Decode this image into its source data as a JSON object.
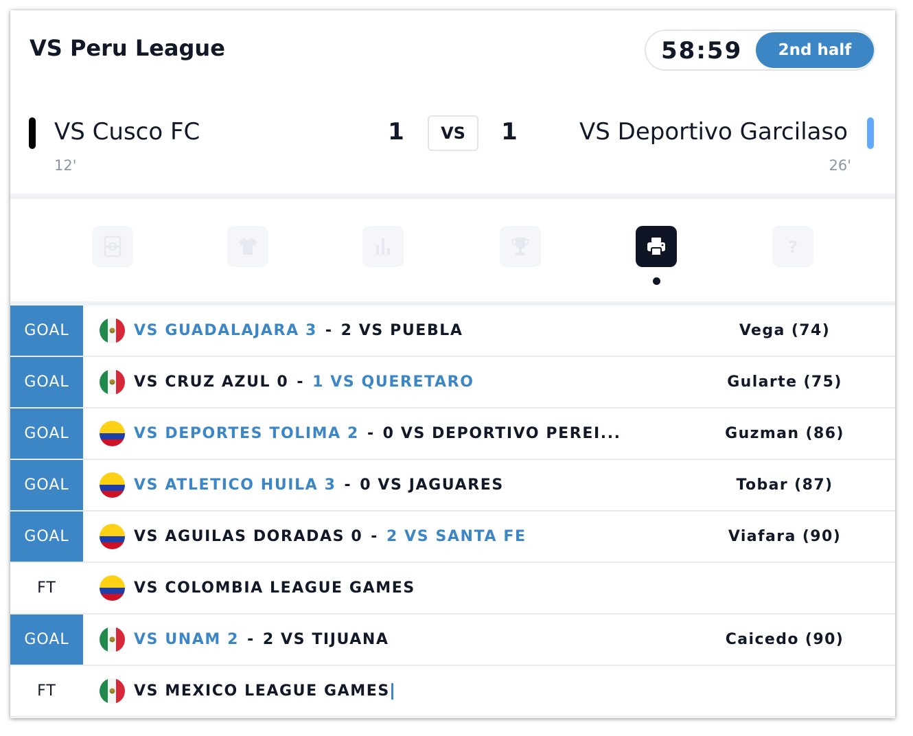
{
  "header": {
    "league": "VS Peru League",
    "clock": "58:59",
    "period": "2nd half",
    "home": {
      "name": "VS Cusco FC",
      "score": "1",
      "minute": "12'",
      "color": "#000000"
    },
    "away": {
      "name": "VS Deportivo Garcilaso",
      "score": "1",
      "minute": "26'",
      "color": "#63a9ff"
    },
    "vs_label": "VS"
  },
  "tabs": [
    {
      "icon": "pitch-icon",
      "active": false
    },
    {
      "icon": "jersey-icon",
      "active": false
    },
    {
      "icon": "stats-icon",
      "active": false
    },
    {
      "icon": "trophy-icon",
      "active": false
    },
    {
      "icon": "printer-icon",
      "active": true
    },
    {
      "icon": "question-icon",
      "active": false
    }
  ],
  "feed": [
    {
      "tag": "GOAL",
      "flag": "mexico-flag-icon",
      "home": "VS GUADALAJARA 3",
      "away": "2 VS PUEBLA",
      "highlight": "home",
      "scorer": "Vega (74)"
    },
    {
      "tag": "GOAL",
      "flag": "mexico-flag-icon",
      "home": "VS CRUZ AZUL 0",
      "away": "1 VS QUERETARO",
      "highlight": "away",
      "scorer": "Gularte (75)"
    },
    {
      "tag": "GOAL",
      "flag": "colombia-flag-icon",
      "home": "VS DEPORTES TOLIMA 2",
      "away": "0 VS DEPORTIVO PEREI...",
      "highlight": "home",
      "scorer": "Guzman (86)"
    },
    {
      "tag": "GOAL",
      "flag": "colombia-flag-icon",
      "home": "VS ATLETICO HUILA 3",
      "away": "0 VS JAGUARES",
      "highlight": "home",
      "scorer": "Tobar (87)"
    },
    {
      "tag": "GOAL",
      "flag": "colombia-flag-icon",
      "home": "VS AGUILAS DORADAS 0",
      "away": "2 VS SANTA FE",
      "highlight": "away",
      "scorer": "Viafara (90)"
    },
    {
      "tag": "FT",
      "flag": "colombia-flag-icon",
      "title": "VS COLOMBIA LEAGUE GAMES"
    },
    {
      "tag": "GOAL",
      "flag": "mexico-flag-icon",
      "home": "VS UNAM 2",
      "away": "2 VS TIJUANA",
      "highlight": "home",
      "scorer": "Caicedo (90)"
    },
    {
      "tag": "FT",
      "flag": "mexico-flag-icon",
      "title": "VS MEXICO LEAGUE GAMES"
    }
  ],
  "colors": {
    "accent": "#3c86c6",
    "dark": "#0f1524"
  }
}
